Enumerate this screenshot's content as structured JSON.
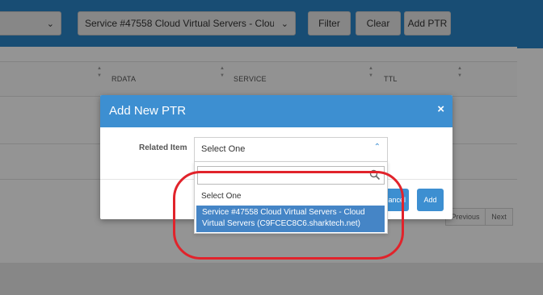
{
  "toolbar": {
    "select_1_value": "",
    "select_2_value": "Service #47558 Cloud Virtual Servers - Cloud Virtual Servers (C9FCEC8C6.sharktech.net)",
    "filter_label": "Filter",
    "clear_label": "Clear",
    "add_ptr_label": "Add PTR"
  },
  "table": {
    "columns": [
      "RDATA",
      "SERVICE",
      "TTL"
    ]
  },
  "pagination": {
    "previous_label": "Previous",
    "next_label": "Next"
  },
  "modal": {
    "title": "Add New PTR",
    "close_symbol": "×",
    "field_label": "Related Item",
    "select_value": "Select One",
    "cancel_label": "Cancel",
    "add_label": "Add"
  },
  "dropdown": {
    "search_value": "",
    "options": [
      {
        "label": "Select One",
        "highlighted": false
      },
      {
        "label": "Service #47558 Cloud Virtual Servers - Cloud Virtual Servers (C9FCEC8C6.sharktech.net)",
        "highlighted": true
      }
    ]
  },
  "colors": {
    "header_blue": "#2a86c8",
    "modal_blue": "#3d8fd1",
    "highlight_blue": "#4585c6",
    "annotation_red": "#e1232b"
  },
  "icons": {
    "select_caret": "chevron-down-icon",
    "dropdown_caret": "chevron-up-icon",
    "search": "search-icon",
    "close": "close-icon"
  }
}
